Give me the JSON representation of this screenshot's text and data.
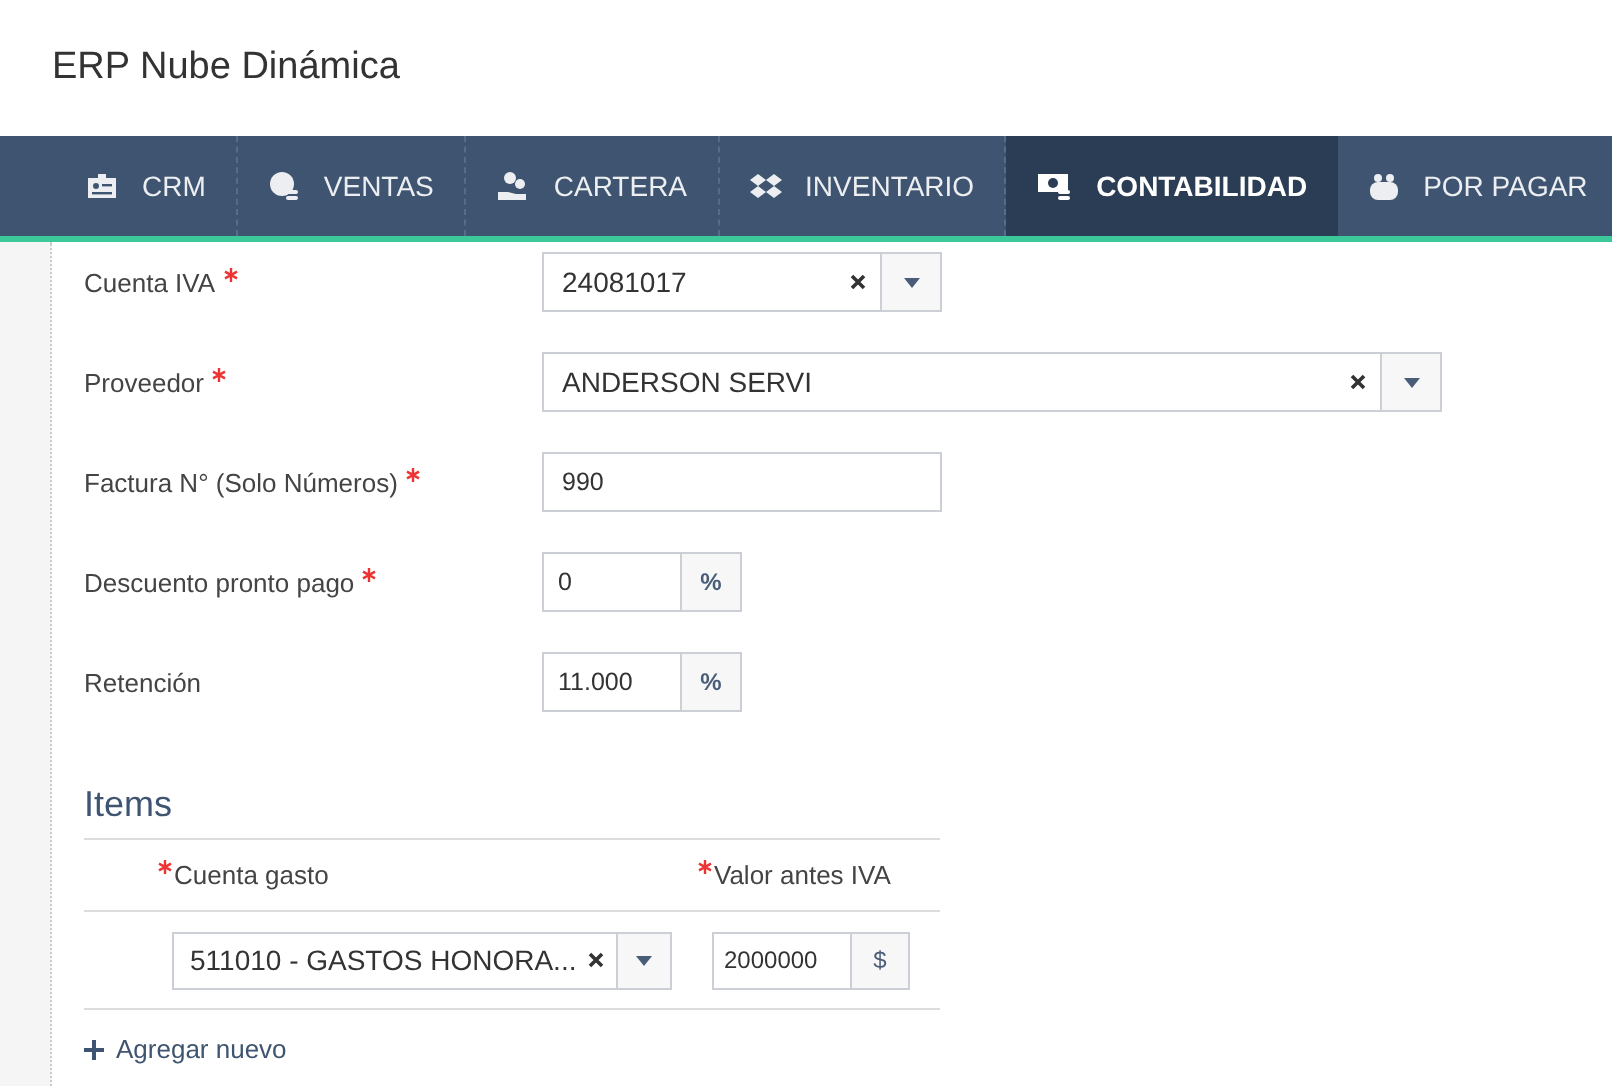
{
  "app_title": "ERP Nube Dinámica",
  "tabs": [
    {
      "label": "CRM",
      "selected": false
    },
    {
      "label": "VENTAS",
      "selected": false
    },
    {
      "label": "CARTERA",
      "selected": false
    },
    {
      "label": "INVENTARIO",
      "selected": false
    },
    {
      "label": "CONTABILIDAD",
      "selected": true
    },
    {
      "label": "POR PAGAR",
      "selected": false
    }
  ],
  "form": [
    {
      "label": "Cuenta IVA",
      "required": true,
      "kind": "select",
      "value": "24081017"
    },
    {
      "label": "Proveedor",
      "required": true,
      "kind": "select",
      "value": "ANDERSON SERVI"
    },
    {
      "label": "Factura N° (Solo Números)",
      "required": true,
      "kind": "input",
      "value": "990"
    },
    {
      "label": "Descuento pronto pago",
      "required": true,
      "kind": "addon",
      "value": "0",
      "addon": "%"
    },
    {
      "label": "Retención",
      "required": false,
      "kind": "addon",
      "value": "11.000",
      "addon": "%"
    }
  ],
  "items": {
    "title": "Items",
    "columns": [
      {
        "label": "Cuenta gasto",
        "required": true
      },
      {
        "label": "Valor antes IVA",
        "required": true
      }
    ],
    "rows": [
      {
        "account": "511010 - GASTOS HONORA...",
        "value": "2000000",
        "addon": "$"
      }
    ],
    "add_label": "Agregar nuevo"
  }
}
